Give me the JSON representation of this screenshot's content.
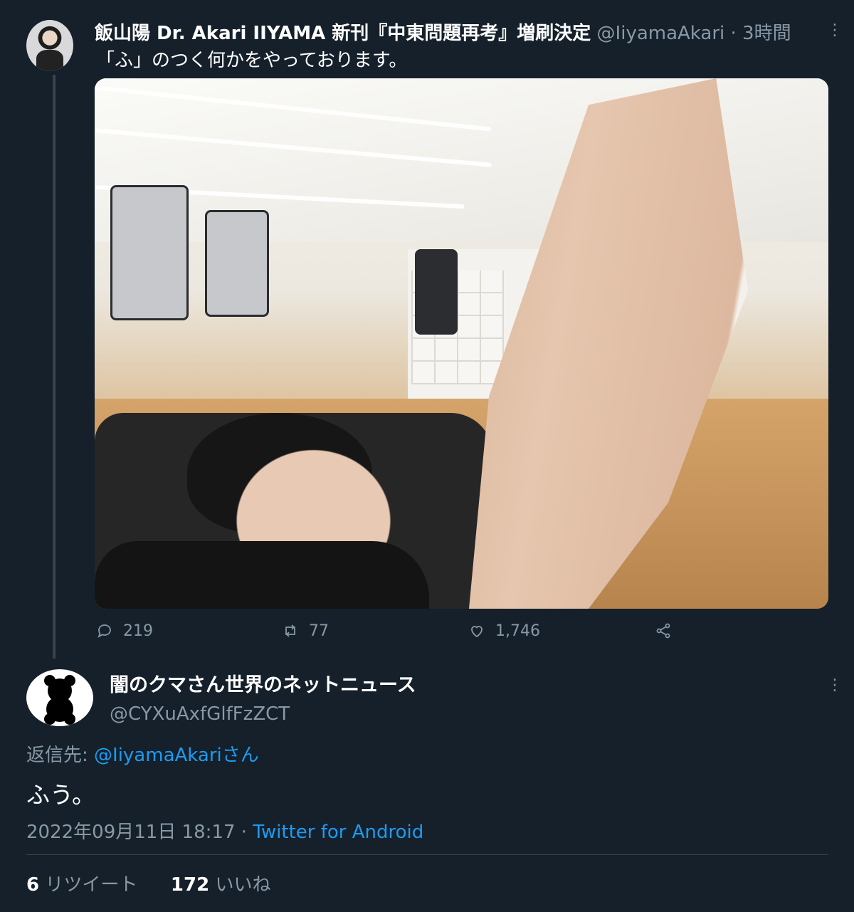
{
  "tweet": {
    "display_name": "飯山陽 Dr. Akari IIYAMA 新刊『中東問題再考』増刷決定",
    "handle": "@IiyamaAkari",
    "separator": "·",
    "time": "3時間",
    "text": "「ふ」のつく何かをやっております。",
    "actions": {
      "replies": "219",
      "retweets": "77",
      "likes": "1,746"
    },
    "more_icon": "⋮"
  },
  "reply": {
    "display_name": "闇のクマさん世界のネットニュース",
    "handle": "@CYXuAxfGlfFzZCT",
    "reply_to_label": "返信先:",
    "reply_to_user": "@IiyamaAkariさん",
    "text": "ふう。",
    "date": "2022年09月11日 18:17",
    "separator": "·",
    "source": "Twitter for Android",
    "stats": {
      "retweets_count": "6",
      "retweets_label": "リツイート",
      "likes_count": "172",
      "likes_label": "いいね"
    },
    "more_icon": "⋮"
  },
  "colors": {
    "background": "#15202b",
    "muted": "#8899a6",
    "link": "#1d9bf0",
    "divider": "#38444d"
  },
  "icons": [
    "reply-icon",
    "retweet-icon",
    "like-icon",
    "share-icon",
    "more-icon"
  ]
}
